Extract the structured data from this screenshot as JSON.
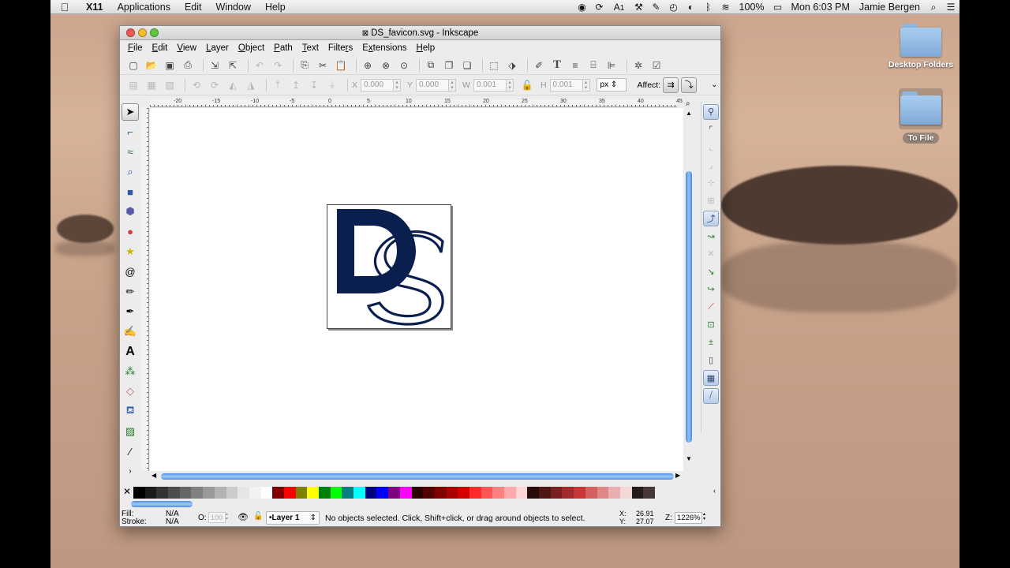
{
  "menubar": {
    "app_name": "X11",
    "items": [
      "Applications",
      "Edit",
      "Window",
      "Help"
    ],
    "battery": "100%",
    "datetime": "Mon 6:03 PM",
    "user": "Jamie Bergen",
    "adobe_badge": "1"
  },
  "desktop": {
    "icons": [
      {
        "label": "Desktop Folders"
      },
      {
        "label": "To File"
      }
    ]
  },
  "window": {
    "title": "DS_favicon.svg - Inkscape",
    "menu": [
      {
        "pre": "",
        "ul": "F",
        "post": "ile"
      },
      {
        "pre": "",
        "ul": "E",
        "post": "dit"
      },
      {
        "pre": "",
        "ul": "V",
        "post": "iew"
      },
      {
        "pre": "",
        "ul": "L",
        "post": "ayer"
      },
      {
        "pre": "",
        "ul": "O",
        "post": "bject"
      },
      {
        "pre": "",
        "ul": "P",
        "post": "ath"
      },
      {
        "pre": "",
        "ul": "T",
        "post": "ext"
      },
      {
        "pre": "Filte",
        "ul": "r",
        "post": "s"
      },
      {
        "pre": "E",
        "ul": "x",
        "post": "tensions"
      },
      {
        "pre": "",
        "ul": "H",
        "post": "elp"
      }
    ]
  },
  "controls": {
    "x_label": "X",
    "x_value": "0.000",
    "y_label": "Y",
    "y_value": "0.000",
    "w_label": "W",
    "w_value": "0.001",
    "h_label": "H",
    "h_value": "0.001",
    "unit": "px",
    "affect_label": "Affect:"
  },
  "rulers": {
    "h_labels": [
      "-20",
      "-15",
      "-10",
      "-5",
      "0",
      "5",
      "10",
      "15",
      "20",
      "25",
      "30",
      "35",
      "40",
      "45"
    ]
  },
  "canvas": {
    "logo_text": "DS",
    "logo_color": "#0b1f4f"
  },
  "palette": {
    "colors": [
      "#000000",
      "#1a1a1a",
      "#333333",
      "#4d4d4d",
      "#666666",
      "#808080",
      "#999999",
      "#b3b3b3",
      "#cccccc",
      "#e6e6e6",
      "#f2f2f2",
      "#ffffff",
      "#800000",
      "#ff0000",
      "#808000",
      "#ffff00",
      "#008000",
      "#00ff00",
      "#008080",
      "#00ffff",
      "#000080",
      "#0000ff",
      "#800080",
      "#ff00ff",
      "#2b0000",
      "#550000",
      "#800000",
      "#aa0000",
      "#d40000",
      "#ff2a2a",
      "#ff5555",
      "#ff8080",
      "#ffaaaa",
      "#ffd5d5",
      "#280b0b",
      "#501616",
      "#782121",
      "#a02c2c",
      "#c83737",
      "#d35f5f",
      "#de8787",
      "#e9afaf",
      "#f4d7d7",
      "#241c1c",
      "#483737"
    ]
  },
  "status": {
    "fill_label": "Fill:",
    "fill_value": "N/A",
    "stroke_label": "Stroke:",
    "stroke_value": "N/A",
    "opacity_label": "O:",
    "opacity_value": "100",
    "layer": "•Layer 1",
    "message": "No objects selected. Click, Shift+click, or drag around objects to select.",
    "x_label": "X:",
    "x_value": "26.91",
    "y_label": "Y:",
    "y_value": "27.07",
    "zoom_label": "Z:",
    "zoom_value": "1226%"
  }
}
